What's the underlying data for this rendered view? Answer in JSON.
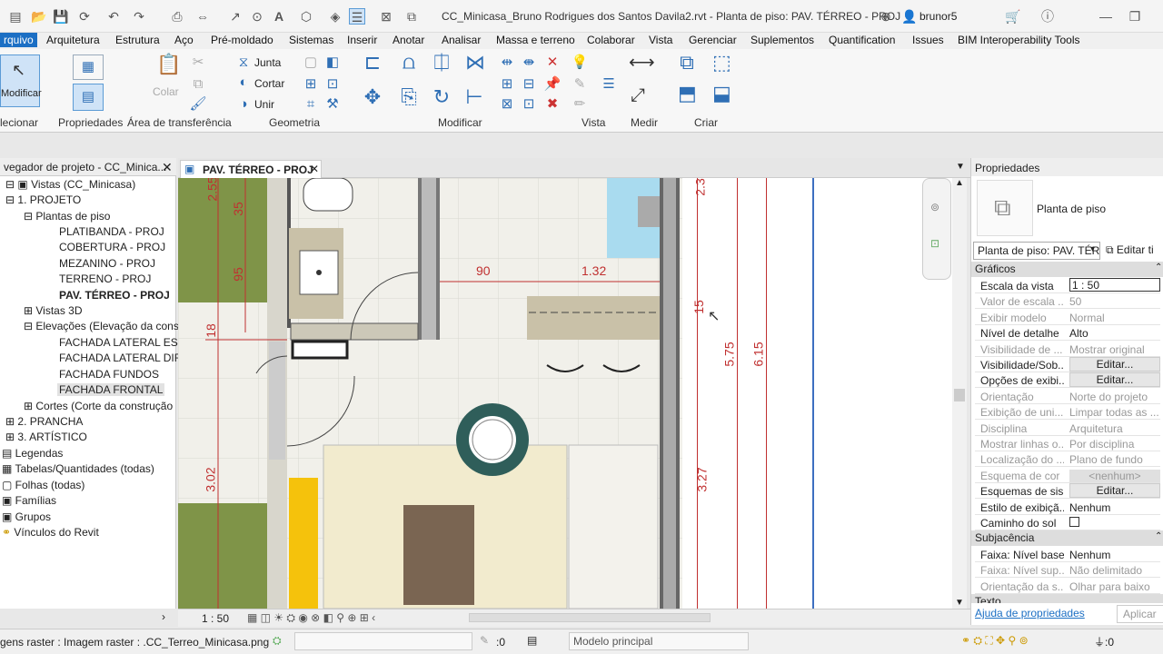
{
  "qat": {
    "title": "CC_Minicasa_Bruno Rodrigues dos Santos Davila2.rvt - Planta de piso: PAV. TÉRREO - PROJ",
    "user": "brunor5"
  },
  "menu": [
    "rquivo",
    "Arquitetura",
    "Estrutura",
    "Aço",
    "Pré-moldado",
    "Sistemas",
    "Inserir",
    "Anotar",
    "Analisar",
    "Massa e terreno",
    "Colaborar",
    "Vista",
    "Gerenciar",
    "Suplementos",
    "Quantification",
    "Issues",
    "BIM Interoperability Tools"
  ],
  "ribbon": {
    "modify": "Modificar",
    "select": "lecionar",
    "properties": "Propriedades",
    "clipboard": "Área de transferência",
    "paste": "Colar",
    "join": "Junta",
    "cut": "Cortar",
    "unite": "Unir",
    "geometry": "Geometria",
    "modify_group": "Modificar",
    "view": "Vista",
    "measure": "Medir",
    "create": "Criar"
  },
  "browser": {
    "title": "vegador de projeto - CC_Minica...",
    "items": [
      "Vistas (CC_Minicasa)",
      "1. PROJETO",
      "Plantas de piso",
      "PLATIBANDA - PROJ",
      "COBERTURA - PROJ",
      "MEZANINO - PROJ",
      "TERRENO - PROJ",
      "PAV. TÉRREO - PROJ",
      "Vistas 3D",
      "Elevações (Elevação da const",
      "FACHADA LATERAL ESQU",
      "FACHADA LATERAL DIRE",
      "FACHADA FUNDOS",
      "FACHADA FRONTAL",
      "Cortes (Corte da construção",
      "2. PRANCHA",
      "3. ARTÍSTICO",
      "Legendas",
      "Tabelas/Quantidades (todas)",
      "Folhas (todas)",
      "Famílias",
      "Grupos",
      "Vínculos do Revit"
    ]
  },
  "view": {
    "tab": "PAV. TÉRREO - PROJ",
    "scale": "1 : 50",
    "dims": [
      "2.55",
      "35",
      "95",
      "18",
      "3.02",
      "90",
      "1.32",
      "15",
      "5.75",
      "6.15",
      "3.27",
      "2.3"
    ]
  },
  "props": {
    "title": "Propriedades",
    "type": "Planta de piso",
    "selector": "Planta de piso: PAV. TÉR",
    "edit_type": "Editar ti",
    "sec_graphics": "Gráficos",
    "sec_underlay": "Subjacência",
    "sec_text": "Texto",
    "rows": [
      [
        "Escala da vista",
        "1 : 50"
      ],
      [
        "Valor de escala ...",
        "50"
      ],
      [
        "Exibir modelo",
        "Normal"
      ],
      [
        "Nível de detalhe",
        "Alto"
      ],
      [
        "Visibilidade de ...",
        "Mostrar original"
      ],
      [
        "Visibilidade/Sob...",
        "Editar..."
      ],
      [
        "Opções de exibi...",
        "Editar..."
      ],
      [
        "Orientação",
        "Norte do projeto"
      ],
      [
        "Exibição de uni...",
        "Limpar todas as ..."
      ],
      [
        "Disciplina",
        "Arquitetura"
      ],
      [
        "Mostrar linhas o...",
        "Por disciplina"
      ],
      [
        "Localização do ...",
        "Plano de fundo"
      ],
      [
        "Esquema de cor",
        "<nenhum>"
      ],
      [
        "Esquemas de sis...",
        "Editar..."
      ],
      [
        "Estilo de exibiçã...",
        "Nenhum"
      ],
      [
        "Caminho do sol",
        ""
      ]
    ],
    "underlay": [
      [
        "Faixa: Nível base",
        "Nenhum"
      ],
      [
        "Faixa: Nível sup...",
        "Não delimitado"
      ],
      [
        "Orientação da s...",
        "Olhar para baixo"
      ]
    ],
    "help": "Ajuda de propriedades",
    "apply": "Aplicar"
  },
  "status": {
    "left": "gens raster : Imagem raster : .CC_Terreo_Minicasa.png",
    "zero1": ":0",
    "model": "Modelo principal",
    "zero2": ":0"
  }
}
